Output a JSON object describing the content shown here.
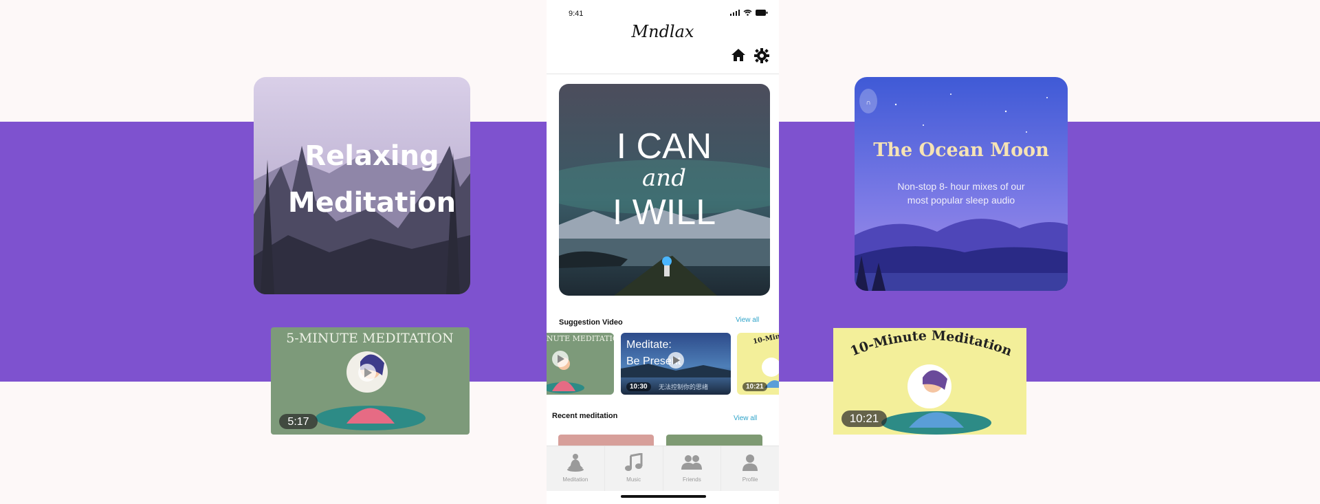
{
  "phone": {
    "status_time": "9:41",
    "app_logo": "Mndlax",
    "header_icons": [
      "home-icon",
      "settings-icon"
    ],
    "hero_card": {
      "line1": "I CAN",
      "line2": "and",
      "line3": "I WILL"
    },
    "suggestion_section": {
      "title": "Suggestion Video",
      "view_all": "View all",
      "videos": [
        {
          "title": "5-MINUTE MEDITATION"
        },
        {
          "title_line1": "Meditate:",
          "title_line2": "Be Present",
          "duration": "10:30",
          "subtitle": "无法控制你的思绪"
        },
        {
          "title": "10-Minute Meditation",
          "duration": "10:21"
        }
      ]
    },
    "recent_section": {
      "title": "Recent meditation",
      "view_all": "View all"
    },
    "tabs": [
      {
        "label": "Meditation",
        "icon": "meditation-icon"
      },
      {
        "label": "Music",
        "icon": "music-icon"
      },
      {
        "label": "Friends",
        "icon": "friends-icon"
      },
      {
        "label": "Profile",
        "icon": "profile-icon"
      }
    ]
  },
  "showcase": {
    "relaxing_card": {
      "line1": "Relaxing",
      "line2": "Meditation"
    },
    "ocean_card": {
      "title": "The Ocean Moon",
      "desc_line1": "Non-stop 8- hour mixes of our",
      "desc_line2": "most popular sleep audio",
      "badge": "∩"
    },
    "five_minute_card": {
      "title": "5-MINUTE MEDITATION",
      "duration": "5:17"
    },
    "ten_minute_card": {
      "title": "10-Minute Meditation",
      "duration": "10:21"
    }
  },
  "colors": {
    "band": "#7e52cf",
    "link": "#2ea3c9",
    "background": "#fdf8f8"
  }
}
